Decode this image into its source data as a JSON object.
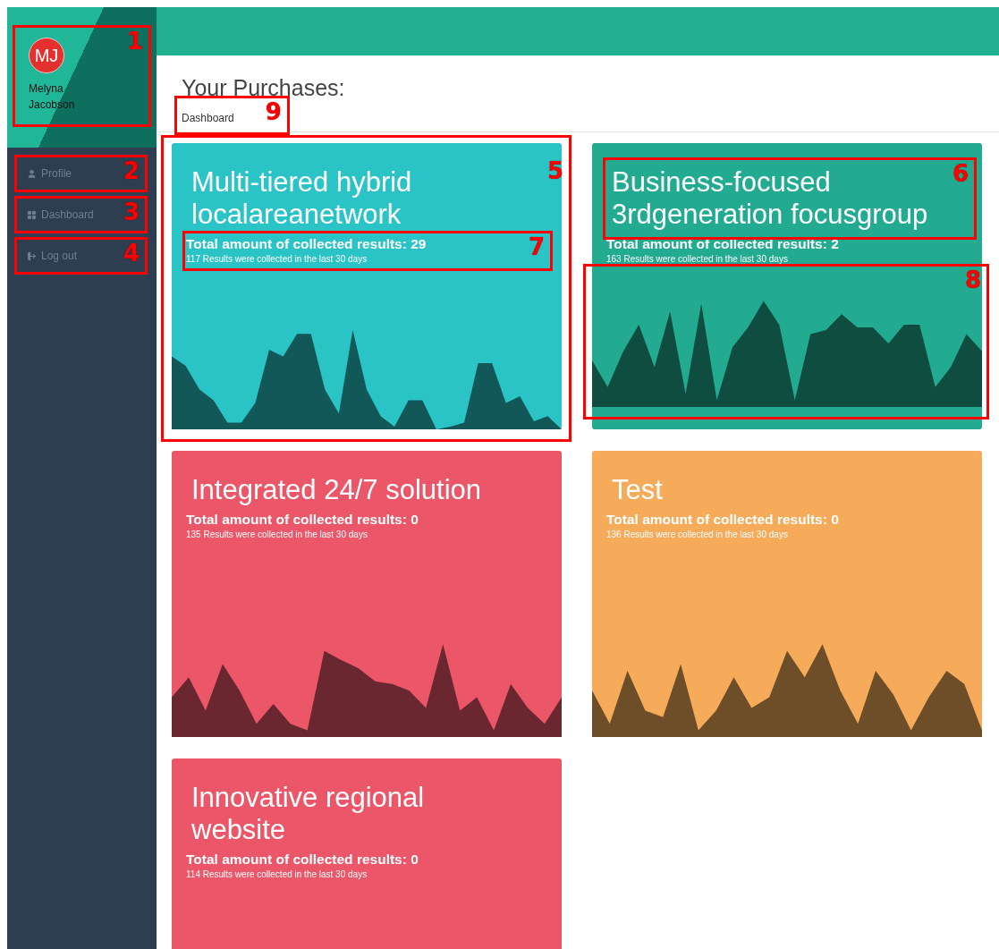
{
  "sidebar": {
    "profile": {
      "initials": "MJ",
      "name": "Melyna Jacobson",
      "annotation": "1"
    },
    "nav": [
      {
        "kind": "profile",
        "label": "Profile",
        "annotation": "2"
      },
      {
        "kind": "dashboard",
        "label": "Dashboard",
        "annotation": "3"
      },
      {
        "kind": "logout",
        "label": "Log out",
        "annotation": "4"
      }
    ]
  },
  "header": {
    "title": "Your Purchases:",
    "breadcrumb": "Dashboard",
    "breadcrumb_annotation": "9"
  },
  "cards": [
    {
      "title": "Multi-tiered hybrid localareanetwork",
      "total": "Total amount of collected results: 29",
      "recent": "117 Results were collected in the last 30 days",
      "color": "#2bc4c6",
      "chart": true,
      "annotation": "5",
      "stats_annotation": "7"
    },
    {
      "title": "Business-focused 3rdgeneration focusgroup",
      "total": "Total amount of collected results: 2",
      "recent": "163 Results were collected in the last 30 days",
      "color": "#22ab91",
      "chart": true,
      "title_annotation": "6",
      "chart_annotation": "8"
    },
    {
      "title": "Integrated 24/7 solution",
      "total": "Total amount of collected results: 0",
      "recent": "135 Results were collected in the last 30 days",
      "color": "#eb5769",
      "chart": true
    },
    {
      "title": "Test",
      "total": "Total amount of collected results: 0",
      "recent": "136 Results were collected in the last 30 days",
      "color": "#f5ab5a",
      "chart": true
    },
    {
      "title": "Innovative regional website",
      "total": "Total amount of collected results: 0",
      "recent": "114 Results were collected in the last 30 days",
      "color": "#eb5769",
      "chart": false
    }
  ]
}
